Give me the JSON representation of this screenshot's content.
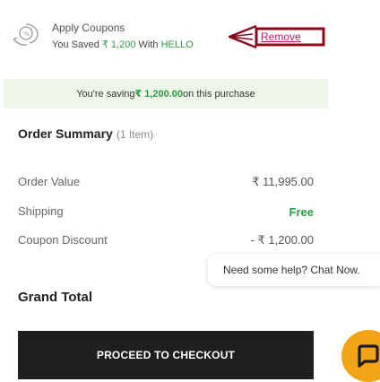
{
  "coupon": {
    "title": "Apply Coupons",
    "saved_prefix": "You Saved ",
    "saved_amount": "₹ 1,200",
    "saved_mid": " With ",
    "code": "HELLO",
    "remove_label": "Remove",
    "annotation_color": "#8b0a1a"
  },
  "saving_banner": {
    "prefix": "You're saving ",
    "amount": "₹ 1,200.00",
    "suffix": " on this purchase"
  },
  "summary": {
    "title": "Order Summary",
    "item_count": "(1 Item)",
    "rows": [
      {
        "label": "Order Value",
        "value": "₹ 11,995.00"
      },
      {
        "label": "Shipping",
        "value": "Free"
      },
      {
        "label": "Coupon Discount",
        "value": "- ₹ 1,200.00"
      }
    ],
    "grand_total_label": "Grand Total"
  },
  "help": {
    "text": "Need some help? Chat Now."
  },
  "checkout": {
    "label": "PROCEED TO CHECKOUT"
  },
  "colors": {
    "accent_green": "#2e9b45",
    "chat_orange": "#f2a316",
    "button_dark": "#1f1f1f"
  },
  "icons": {
    "coupon": "coupon-tag-icon",
    "chat": "chat-bubble-icon"
  }
}
